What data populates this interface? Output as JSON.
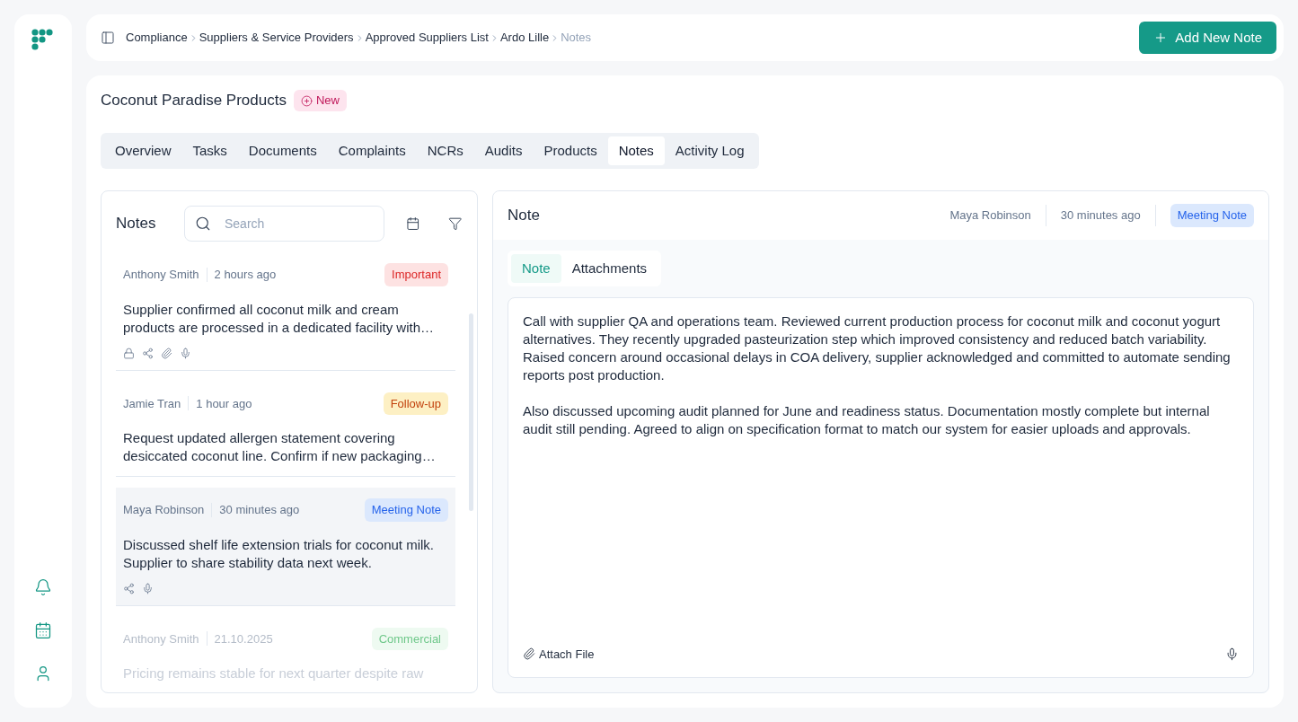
{
  "breadcrumb": [
    {
      "label": "Compliance",
      "current": false
    },
    {
      "label": "Suppliers & Service Providers",
      "current": false
    },
    {
      "label": "Approved Suppliers List",
      "current": false
    },
    {
      "label": "Ardo Lille",
      "current": false
    },
    {
      "label": "Notes",
      "current": true
    }
  ],
  "add_button": "Add New Note",
  "supplier": {
    "name": "Coconut Paradise Products",
    "badge": "New"
  },
  "tabs": [
    {
      "label": "Overview",
      "selected": false
    },
    {
      "label": "Tasks",
      "selected": false
    },
    {
      "label": "Documents",
      "selected": false
    },
    {
      "label": "Complaints",
      "selected": false
    },
    {
      "label": "NCRs",
      "selected": false
    },
    {
      "label": "Audits",
      "selected": false
    },
    {
      "label": "Products",
      "selected": false
    },
    {
      "label": "Notes",
      "selected": true
    },
    {
      "label": "Activity Log",
      "selected": false
    }
  ],
  "notes_panel": {
    "title": "Notes",
    "search": {
      "placeholder": "Search"
    },
    "notes": [
      {
        "author": "Anthony Smith",
        "time": "2 hours ago",
        "tag": {
          "label": "Important",
          "color": "#dc2626"
        },
        "body": "Supplier confirmed all coconut milk and cream products are processed in a dedicated facility with…",
        "locked": true,
        "shared": true,
        "has_attachment": true,
        "has_audio": true,
        "selected": false
      },
      {
        "author": "Jamie Tran",
        "time": "1 hour ago",
        "tag": {
          "label": "Follow-up",
          "color": "#c2410c"
        },
        "body": "Request updated allergen statement covering desiccated coconut line. Confirm if new packaging…",
        "locked": false,
        "shared": false,
        "has_attachment": false,
        "has_audio": false,
        "selected": false
      },
      {
        "author": "Maya Robinson",
        "time": "30 minutes ago",
        "tag": {
          "label": "Meeting Note",
          "color": "#2563eb"
        },
        "body": "Discussed shelf life extension trials for coconut milk. Supplier to share stability data next week.",
        "locked": false,
        "shared": true,
        "has_attachment": false,
        "has_audio": true,
        "selected": true
      },
      {
        "author": "Anthony Smith",
        "time": "21.10.2025",
        "tag": {
          "label": "Commercial",
          "color": "#6fc88a"
        },
        "body": "Pricing remains stable for next quarter despite raw",
        "locked": false,
        "shared": false,
        "has_attachment": false,
        "has_audio": false,
        "selected": false
      }
    ]
  },
  "note_detail": {
    "title": "Note",
    "author": "Maya Robinson",
    "time": "30 minutes ago",
    "tag": {
      "label": "Meeting Note",
      "color": "#2563eb"
    },
    "tabs": [
      {
        "label": "Note",
        "selected": true
      },
      {
        "label": "Attachments",
        "selected": false
      }
    ],
    "paragraphs": [
      "Call with supplier QA and operations team. Reviewed current production process for coconut milk and coconut yogurt alternatives. They recently upgraded pasteurization step which improved consistency and reduced batch variability. Raised concern around occasional delays in COA delivery, supplier acknowledged and committed to automate sending reports post production.",
      "Also discussed upcoming audit planned for June and readiness status. Documentation mostly complete but internal audit still pending. Agreed to align on specification format to match our system for easier uploads and approvals."
    ],
    "attach_button": "Attach File"
  }
}
